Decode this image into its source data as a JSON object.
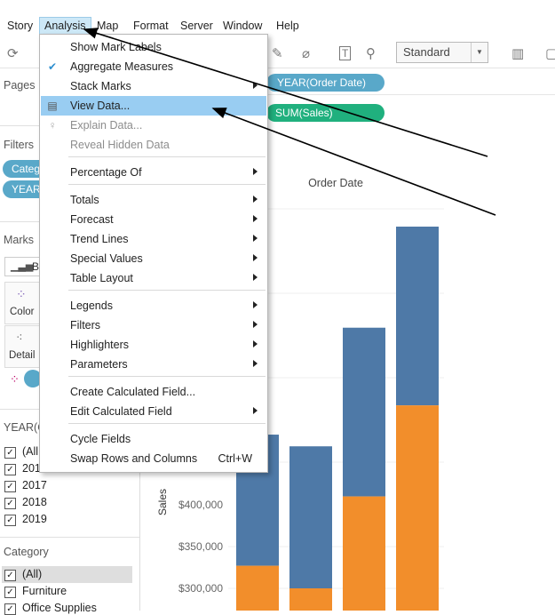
{
  "menubar": [
    "Story",
    "Analysis",
    "Map",
    "Format",
    "Server",
    "Window",
    "Help"
  ],
  "toolbar": {
    "view_mode": "Standard"
  },
  "shelves": {
    "columns_pill": "YEAR(Order Date)",
    "rows_pill": "SUM(Sales)"
  },
  "left": {
    "pages": "Pages",
    "filters": "Filters",
    "filter_pills": [
      "Categ",
      "YEAR"
    ],
    "marks": "Marks",
    "marks_type": "Ba",
    "color_label": "Color",
    "detail_label": "Detail",
    "year_title": "YEAR(O",
    "year_items": [
      "(All",
      "201",
      "2017",
      "2018",
      "2019"
    ],
    "category_title": "Category",
    "category_items": [
      "(All)",
      "Furniture",
      "Office Supplies"
    ]
  },
  "menu": {
    "items": [
      {
        "label": "Show Mark Labels",
        "icon": "",
        "submenu": false,
        "disabled": false
      },
      {
        "label": "Aggregate Measures",
        "icon": "check-icon",
        "submenu": false,
        "disabled": false
      },
      {
        "label": "Stack Marks",
        "icon": "",
        "submenu": true,
        "disabled": false
      },
      {
        "label": "View Data...",
        "icon": "table-icon",
        "submenu": false,
        "disabled": false,
        "highlighted": true
      },
      {
        "label": "Explain Data...",
        "icon": "lightbulb-icon",
        "submenu": false,
        "disabled": true
      },
      {
        "label": "Reveal Hidden Data",
        "icon": "",
        "submenu": false,
        "disabled": true
      },
      {
        "label": "Percentage Of",
        "submenu": true
      },
      {
        "label": "Totals",
        "submenu": true
      },
      {
        "label": "Forecast",
        "submenu": true
      },
      {
        "label": "Trend Lines",
        "submenu": true
      },
      {
        "label": "Special Values",
        "submenu": true
      },
      {
        "label": "Table Layout",
        "submenu": true
      },
      {
        "label": "Legends",
        "submenu": true
      },
      {
        "label": "Filters",
        "submenu": true
      },
      {
        "label": "Highlighters",
        "submenu": true
      },
      {
        "label": "Parameters",
        "submenu": true
      },
      {
        "label": "Create Calculated Field...",
        "submenu": false
      },
      {
        "label": "Edit Calculated Field",
        "submenu": true
      },
      {
        "label": "Cycle Fields",
        "submenu": false
      },
      {
        "label": "Swap Rows and Columns",
        "shortcut": "Ctrl+W",
        "submenu": false
      }
    ]
  },
  "chart_data": {
    "type": "bar",
    "title": "Order Date",
    "ylabel": "Sales",
    "ylim": [
      280000,
      760000
    ],
    "yticks": [
      "$300,000",
      "$350,000",
      "$400,000"
    ],
    "colors": {
      "blue": "#4e79a7",
      "orange": "#f28e2b"
    },
    "series": [
      {
        "name": "bottom",
        "color": "#f28e2b",
        "values": [
          327000,
          300000,
          410000,
          519000
        ]
      },
      {
        "name": "top",
        "color": "#4e79a7",
        "values": [
          484000,
          470000,
          612000,
          733000
        ]
      }
    ]
  }
}
